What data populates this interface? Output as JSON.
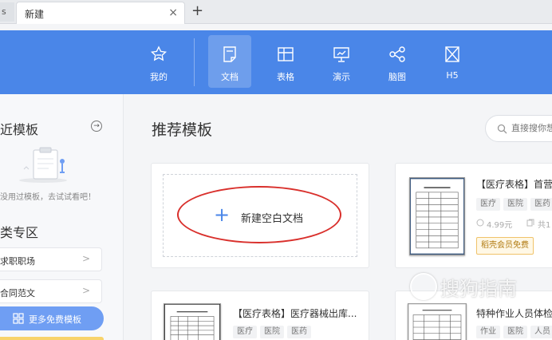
{
  "tabs": {
    "partial_label": "s",
    "active_label": "新建",
    "close_glyph": "×",
    "add_glyph": "+"
  },
  "nav": {
    "items": [
      {
        "label": "我的",
        "icon": "star-icon"
      },
      {
        "label": "文档",
        "icon": "document-icon",
        "active": true
      },
      {
        "label": "表格",
        "icon": "table-icon"
      },
      {
        "label": "演示",
        "icon": "presentation-icon"
      },
      {
        "label": "脑图",
        "icon": "mindmap-icon"
      },
      {
        "label": "H5",
        "icon": "h5-icon"
      }
    ],
    "color": "#4a86e8"
  },
  "sidebar": {
    "recent_title": "近模板",
    "recent_arrow": "→",
    "empty_text": "没用过模板，去试试看吧！",
    "category_title": "类专区",
    "links": [
      {
        "label": "求职职场",
        "chevron": ">"
      },
      {
        "label": "合同范文",
        "chevron": ">"
      }
    ],
    "more_button": "更多免费模板"
  },
  "main": {
    "title": "推荐模板",
    "search_placeholder": "直接搜你想",
    "new_blank": {
      "plus": "+",
      "label": "新建空白文档"
    },
    "templates": [
      {
        "title": "【医疗表格】首营",
        "tags": [
          "医疗",
          "医院",
          "医药"
        ],
        "price": "4.99元",
        "extra": "共1",
        "member_badge": "稻壳会员免费"
      },
      {
        "title": "【医疗表格】医疗器械出库...",
        "tags": [
          "医疗",
          "医院",
          "医药"
        ]
      },
      {
        "title": "特种作业人员体检",
        "tags": [
          "作业",
          "医院",
          "人员"
        ]
      }
    ]
  },
  "watermark": "搜狗指南",
  "colors": {
    "accent": "#4a86e8",
    "highlight_ellipse": "#d9302c"
  }
}
